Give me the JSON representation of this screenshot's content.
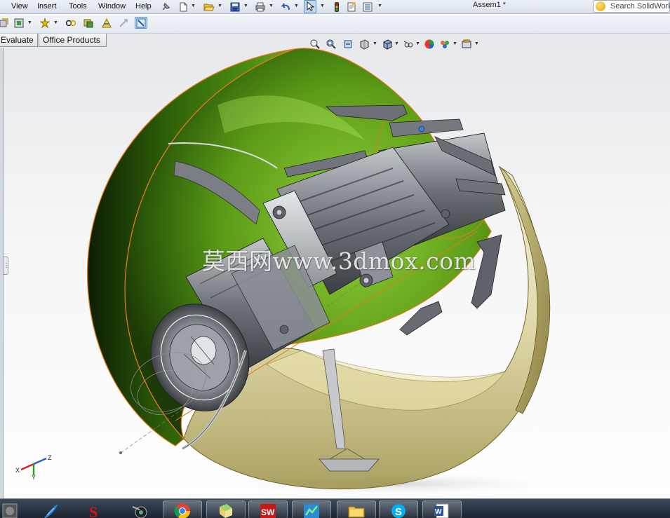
{
  "menubar": {
    "items": [
      "View",
      "Insert",
      "Tools",
      "Window",
      "Help"
    ],
    "document_title": "Assem1 *",
    "search_placeholder": "Search SolidWorks"
  },
  "command_tabs": [
    "Evaluate",
    "Office Products"
  ],
  "toolbar_icons": [
    "new-document-icon",
    "open-folder-icon",
    "save-icon",
    "print-icon",
    "undo-icon",
    "select-arrow-icon",
    "rebuild-traffic-light-icon",
    "file-properties-icon",
    "options-icon"
  ],
  "assembly_toolbar_icons": [
    "insert-component-icon",
    "mate-icon",
    "smart-fasteners-icon",
    "move-component-icon",
    "explode-view-icon",
    "reference-geometry-icon",
    "bill-of-materials-icon",
    "instant3d-icon"
  ],
  "view_toolbar_icons": [
    "zoom-to-fit-icon",
    "zoom-to-area-icon",
    "previous-view-icon",
    "section-view-icon",
    "view-orientation-icon",
    "display-style-icon",
    "hide-show-items-icon",
    "edit-appearance-icon",
    "apply-scene-icon",
    "view-settings-icon"
  ],
  "watermark": "莫西网www.3dmox.com",
  "triad_axes": [
    "X",
    "Y",
    "Z"
  ],
  "taskbar_apps": [
    "system-icon",
    "quill-app-icon",
    "solidworks-s-icon",
    "camera-app-icon",
    "chrome-icon",
    "file-manager-icon",
    "solidworks-sw-icon",
    "chart-app-icon",
    "folder-icon",
    "skype-icon",
    "word-icon"
  ],
  "colors": {
    "sphere_green": "#5a9a16",
    "sphere_tan": "#d6cd8e",
    "edge_orange": "#e07a1a",
    "part_gray": "#6e7379",
    "accent_blue": "#3d7dd6"
  }
}
